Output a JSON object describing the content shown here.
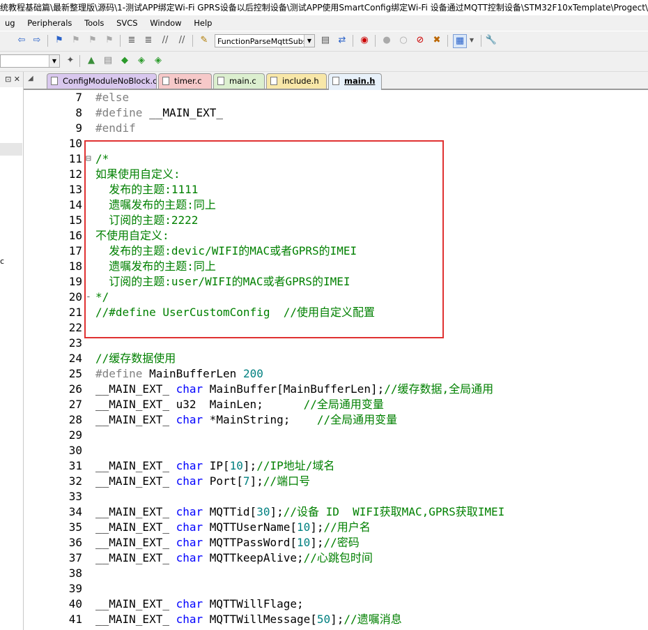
{
  "window": {
    "title": "统教程基础篇\\最新整理版\\源码\\1-测试APP绑定Wi-Fi  GPRS设备以后控制设备\\测试APP使用SmartConfig绑定Wi-Fi 设备通过MQTT控制设备\\STM32F10xTemplate\\Progect\\"
  },
  "menu": {
    "items": [
      "ug",
      "Peripherals",
      "Tools",
      "SVCS",
      "Window",
      "Help"
    ]
  },
  "toolbar": {
    "function_combo_value": "FunctionParseMqttSubsc"
  },
  "left_panel": {
    "fragment": "c"
  },
  "tabs": [
    {
      "label": "ConfigModuleNoBlock.c",
      "color": "#d9c8ee",
      "active": false
    },
    {
      "label": "timer.c",
      "color": "#f6c9c9",
      "active": false
    },
    {
      "label": "main.c",
      "color": "#dcefcf",
      "active": false
    },
    {
      "label": "include.h",
      "color": "#f8e7a8",
      "active": false
    },
    {
      "label": "main.h",
      "color": "#e8f1fa",
      "active": true
    }
  ],
  "colors": {
    "keyword": "#0000ff",
    "preprocessor": "#808080",
    "comment": "#008000",
    "number": "#008080",
    "highlight_box": "#e03131"
  },
  "code": [
    {
      "n": "7",
      "fold": "",
      "t": [
        [
          "pp",
          "#else"
        ]
      ]
    },
    {
      "n": "8",
      "fold": "",
      "t": [
        [
          "pp",
          "#define"
        ],
        [
          "plain",
          " __MAIN_EXT_"
        ]
      ]
    },
    {
      "n": "9",
      "fold": "",
      "t": [
        [
          "pp",
          "#endif"
        ]
      ]
    },
    {
      "n": "10",
      "fold": "",
      "t": []
    },
    {
      "n": "11",
      "fold": "⊟",
      "t": [
        [
          "cm",
          "/*"
        ]
      ]
    },
    {
      "n": "12",
      "fold": "",
      "t": [
        [
          "cm",
          "如果使用自定义:"
        ]
      ]
    },
    {
      "n": "13",
      "fold": "",
      "t": [
        [
          "cm",
          "  发布的主题:1111"
        ]
      ]
    },
    {
      "n": "14",
      "fold": "",
      "t": [
        [
          "cm",
          "  遗嘱发布的主题:同上"
        ]
      ]
    },
    {
      "n": "15",
      "fold": "",
      "t": [
        [
          "cm",
          "  订阅的主题:2222"
        ]
      ]
    },
    {
      "n": "16",
      "fold": "",
      "t": [
        [
          "cm",
          "不使用自定义:"
        ]
      ]
    },
    {
      "n": "17",
      "fold": "",
      "t": [
        [
          "cm",
          "  发布的主题:devic/WIFI的MAC或者GPRS的IMEI"
        ]
      ]
    },
    {
      "n": "18",
      "fold": "",
      "t": [
        [
          "cm",
          "  遗嘱发布的主题:同上"
        ]
      ]
    },
    {
      "n": "19",
      "fold": "",
      "t": [
        [
          "cm",
          "  订阅的主题:user/WIFI的MAC或者GPRS的IMEI"
        ]
      ]
    },
    {
      "n": "20",
      "fold": "-",
      "t": [
        [
          "cm",
          "*/"
        ]
      ]
    },
    {
      "n": "21",
      "fold": "",
      "t": [
        [
          "cm",
          "//#define UserCustomConfig  //使用自定义配置"
        ]
      ]
    },
    {
      "n": "22",
      "fold": "",
      "t": []
    },
    {
      "n": "23",
      "fold": "",
      "t": []
    },
    {
      "n": "24",
      "fold": "",
      "t": [
        [
          "cm",
          "//缓存数据使用"
        ]
      ]
    },
    {
      "n": "25",
      "fold": "",
      "t": [
        [
          "pp",
          "#define"
        ],
        [
          "plain",
          " MainBufferLen "
        ],
        [
          "num",
          "200"
        ]
      ]
    },
    {
      "n": "26",
      "fold": "",
      "t": [
        [
          "plain",
          "__MAIN_EXT_ "
        ],
        [
          "kw",
          "char"
        ],
        [
          "plain",
          " MainBuffer[MainBufferLen];"
        ],
        [
          "cm",
          "//缓存数据,全局通用"
        ]
      ]
    },
    {
      "n": "27",
      "fold": "",
      "t": [
        [
          "plain",
          "__MAIN_EXT_ u32  MainLen;      "
        ],
        [
          "cm",
          "//全局通用变量"
        ]
      ]
    },
    {
      "n": "28",
      "fold": "",
      "t": [
        [
          "plain",
          "__MAIN_EXT_ "
        ],
        [
          "kw",
          "char"
        ],
        [
          "plain",
          " *MainString;    "
        ],
        [
          "cm",
          "//全局通用变量"
        ]
      ]
    },
    {
      "n": "29",
      "fold": "",
      "t": []
    },
    {
      "n": "30",
      "fold": "",
      "t": []
    },
    {
      "n": "31",
      "fold": "",
      "t": [
        [
          "plain",
          "__MAIN_EXT_ "
        ],
        [
          "kw",
          "char"
        ],
        [
          "plain",
          " IP["
        ],
        [
          "num",
          "10"
        ],
        [
          "plain",
          "];"
        ],
        [
          "cm",
          "//IP地址/域名"
        ]
      ]
    },
    {
      "n": "32",
      "fold": "",
      "t": [
        [
          "plain",
          "__MAIN_EXT_ "
        ],
        [
          "kw",
          "char"
        ],
        [
          "plain",
          " Port["
        ],
        [
          "num",
          "7"
        ],
        [
          "plain",
          "];"
        ],
        [
          "cm",
          "//端口号"
        ]
      ]
    },
    {
      "n": "33",
      "fold": "",
      "t": []
    },
    {
      "n": "34",
      "fold": "",
      "t": [
        [
          "plain",
          "__MAIN_EXT_ "
        ],
        [
          "kw",
          "char"
        ],
        [
          "plain",
          " MQTTid["
        ],
        [
          "num",
          "30"
        ],
        [
          "plain",
          "];"
        ],
        [
          "cm",
          "//设备 ID  WIFI获取MAC,GPRS获取IMEI"
        ]
      ]
    },
    {
      "n": "35",
      "fold": "",
      "t": [
        [
          "plain",
          "__MAIN_EXT_ "
        ],
        [
          "kw",
          "char"
        ],
        [
          "plain",
          " MQTTUserName["
        ],
        [
          "num",
          "10"
        ],
        [
          "plain",
          "];"
        ],
        [
          "cm",
          "//用户名"
        ]
      ]
    },
    {
      "n": "36",
      "fold": "",
      "t": [
        [
          "plain",
          "__MAIN_EXT_ "
        ],
        [
          "kw",
          "char"
        ],
        [
          "plain",
          " MQTTPassWord["
        ],
        [
          "num",
          "10"
        ],
        [
          "plain",
          "];"
        ],
        [
          "cm",
          "//密码"
        ]
      ]
    },
    {
      "n": "37",
      "fold": "",
      "t": [
        [
          "plain",
          "__MAIN_EXT_ "
        ],
        [
          "kw",
          "char"
        ],
        [
          "plain",
          " MQTTkeepAlive;"
        ],
        [
          "cm",
          "//心跳包时间"
        ]
      ]
    },
    {
      "n": "38",
      "fold": "",
      "t": []
    },
    {
      "n": "39",
      "fold": "",
      "t": []
    },
    {
      "n": "40",
      "fold": "",
      "t": [
        [
          "plain",
          "__MAIN_EXT_ "
        ],
        [
          "kw",
          "char"
        ],
        [
          "plain",
          " MQTTWillFlage;"
        ]
      ]
    },
    {
      "n": "41",
      "fold": "",
      "t": [
        [
          "plain",
          "__MAIN_EXT_ "
        ],
        [
          "kw",
          "char"
        ],
        [
          "plain",
          " MQTTWillMessage["
        ],
        [
          "num",
          "50"
        ],
        [
          "plain",
          "];"
        ],
        [
          "cm",
          "//遗嘱消息"
        ]
      ]
    }
  ]
}
